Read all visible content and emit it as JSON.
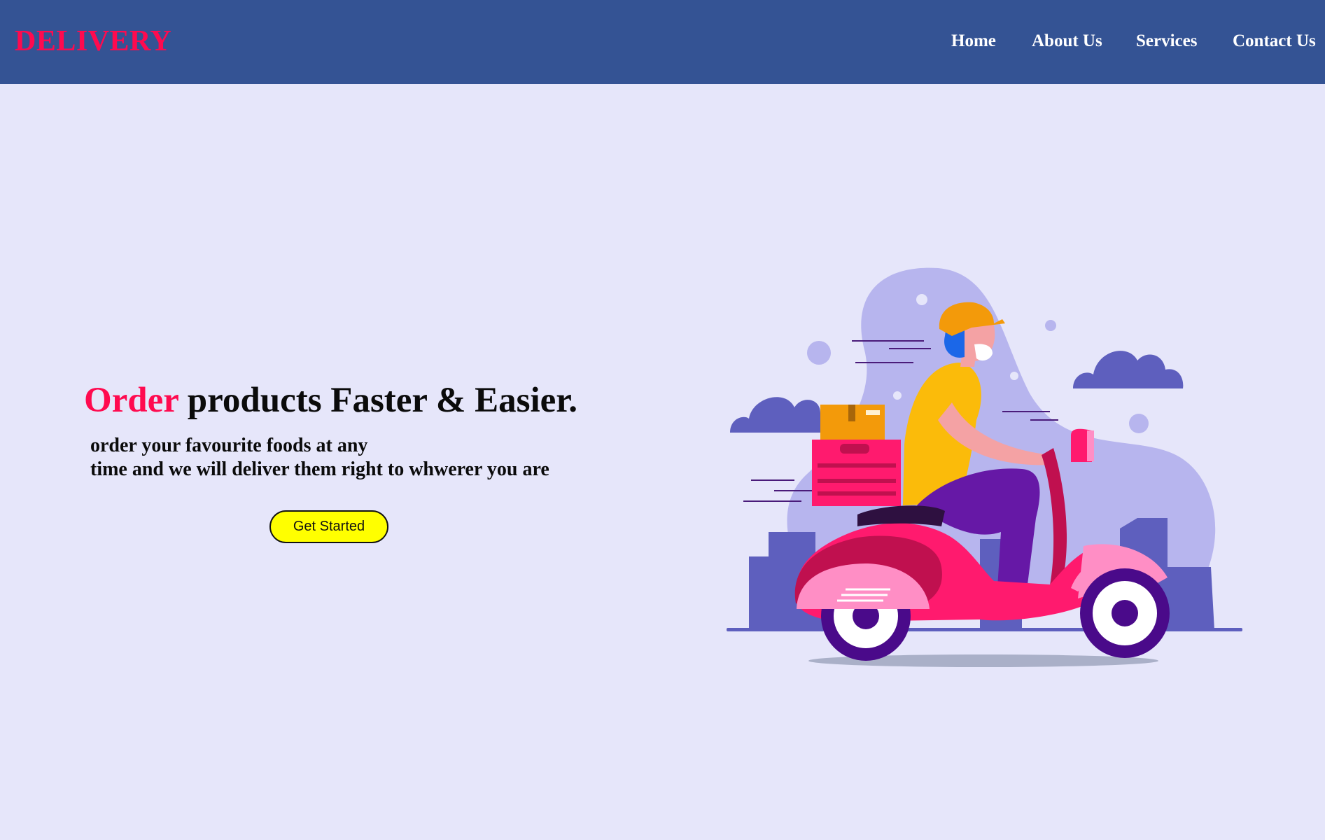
{
  "header": {
    "logo": "DELIVERY",
    "nav": [
      {
        "label": "Home"
      },
      {
        "label": "About Us"
      },
      {
        "label": "Services"
      },
      {
        "label": "Contact Us"
      }
    ]
  },
  "hero": {
    "headline_accent": "Order",
    "headline_rest": " products Faster & Easier.",
    "subtitle_line1": "order your favourite foods at any",
    "subtitle_line2": "time and we will deliver them right to whwerer you are",
    "cta_label": "Get Started",
    "illustration_icon": "delivery-scooter-illustration"
  },
  "colors": {
    "navbar": "#345394",
    "background": "#e6e6fa",
    "accent": "#ff0a4f",
    "cta": "#ffff00"
  }
}
